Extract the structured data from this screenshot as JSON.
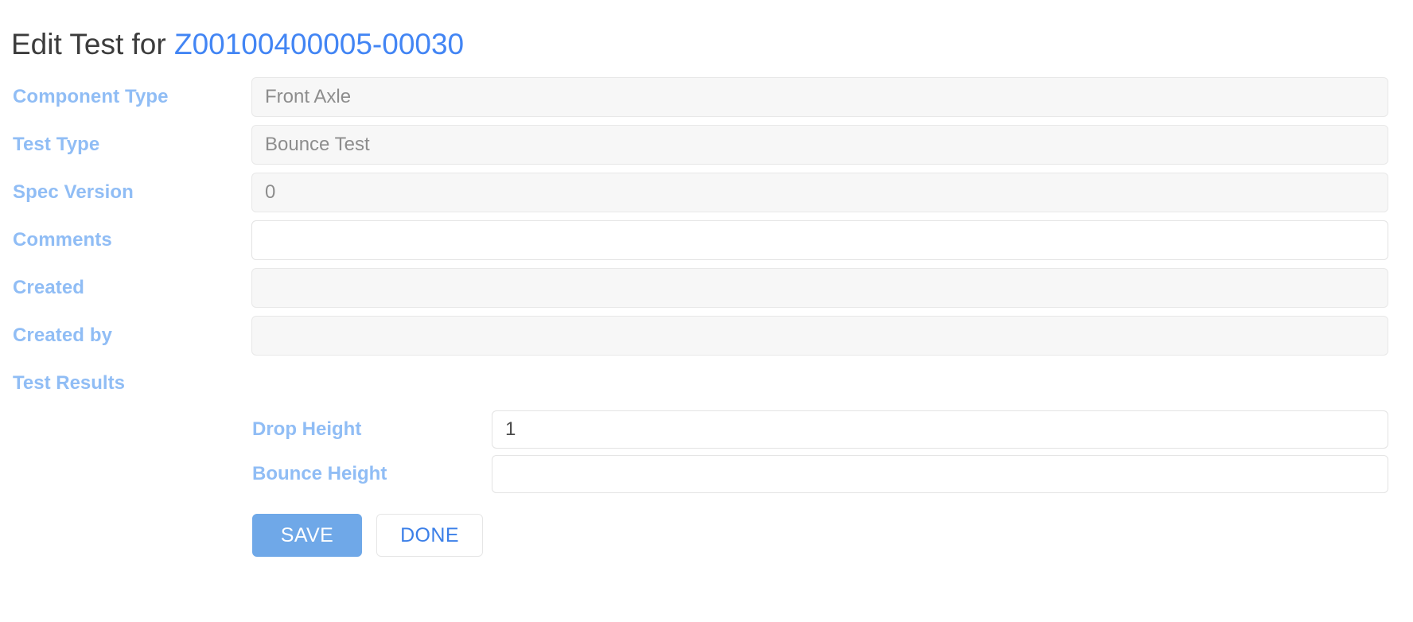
{
  "header": {
    "title_prefix": "Edit Test for ",
    "record_id": "Z00100400005-00030"
  },
  "form": {
    "fields": [
      {
        "label": "Component Type",
        "value": "Front Axle",
        "placeholder": "",
        "disabled": true
      },
      {
        "label": "Test Type",
        "value": "Bounce Test",
        "placeholder": "",
        "disabled": true
      },
      {
        "label": "Spec Version",
        "value": "0",
        "placeholder": "",
        "disabled": true
      },
      {
        "label": "Comments",
        "value": "",
        "placeholder": "",
        "disabled": false
      },
      {
        "label": "Created",
        "value": "",
        "placeholder": "",
        "disabled": true
      },
      {
        "label": "Created by",
        "value": "",
        "placeholder": "",
        "disabled": true
      }
    ]
  },
  "test_results": {
    "section_label": "Test Results",
    "rows": [
      {
        "label": "Drop Height",
        "value": "1",
        "placeholder": ""
      },
      {
        "label": "Bounce Height",
        "value": "",
        "placeholder": ""
      }
    ]
  },
  "actions": {
    "save_label": "SAVE",
    "done_label": "DONE"
  },
  "colors": {
    "label_blue": "#90bdf5",
    "link_blue": "#4285f4",
    "save_button": "#6fa8e8",
    "done_text": "#3b7fe8",
    "disabled_field_bg": "#f7f7f7",
    "field_border": "#e3e3e3",
    "title_text": "#3c3c3c"
  }
}
